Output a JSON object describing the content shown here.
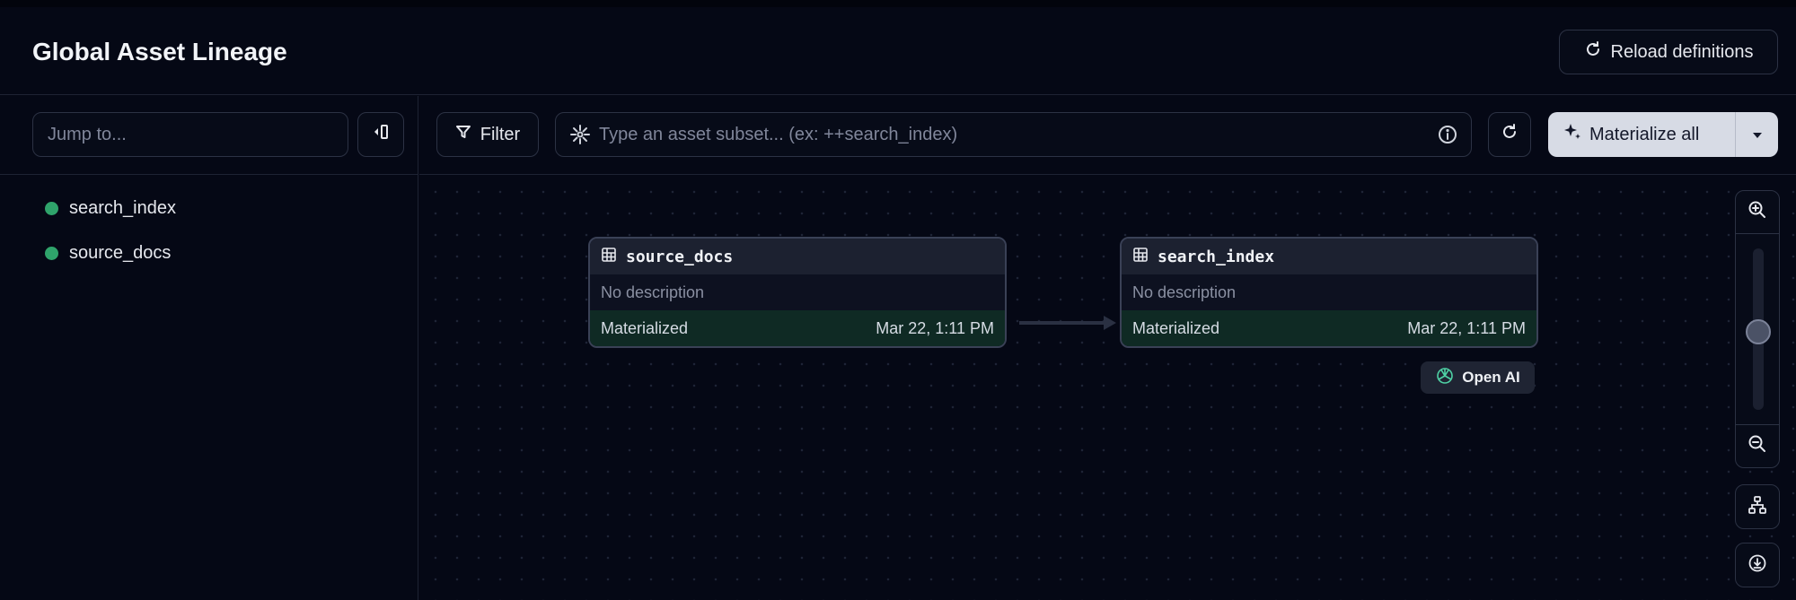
{
  "header": {
    "title": "Global Asset Lineage",
    "reload_label": "Reload definitions"
  },
  "sidebar": {
    "search_placeholder": "Jump to...",
    "items": [
      {
        "label": "search_index",
        "status_color": "#2fa36b"
      },
      {
        "label": "source_docs",
        "status_color": "#2fa36b"
      }
    ]
  },
  "toolbar": {
    "filter_label": "Filter",
    "subset_placeholder": "Type an asset subset... (ex: ++search_index)",
    "materialize_label": "Materialize all"
  },
  "graph": {
    "nodes": [
      {
        "name": "source_docs",
        "description": "No description",
        "status": "Materialized",
        "timestamp": "Mar 22, 1:11 PM"
      },
      {
        "name": "search_index",
        "description": "No description",
        "status": "Materialized",
        "timestamp": "Mar 22, 1:11 PM"
      }
    ],
    "tag_label": "Open AI",
    "zoom_level": 0.15
  },
  "colors": {
    "background": "#050815",
    "materialized": "#0f2a24",
    "status_dot": "#2fa36b",
    "accent_button": "#d7dbe5"
  },
  "icons": [
    "refresh-icon",
    "panel-collapse-icon",
    "filter-icon",
    "asset-selection-icon",
    "info-icon",
    "sparkle-icon",
    "chevron-down-icon",
    "table-icon",
    "openai-icon",
    "zoom-in-icon",
    "zoom-out-icon",
    "layout-icon",
    "download-icon"
  ]
}
